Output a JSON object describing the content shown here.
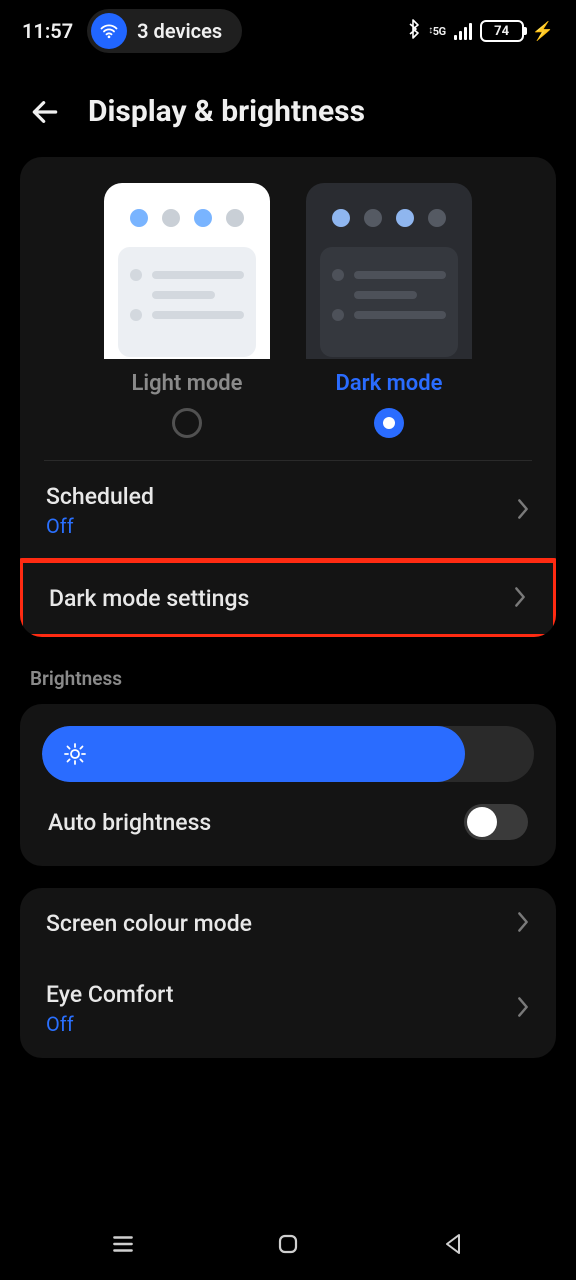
{
  "statusbar": {
    "time": "11:57",
    "devices_label": "3 devices",
    "network_label": "5G",
    "battery": "74"
  },
  "header": {
    "title": "Display & brightness"
  },
  "theme": {
    "light_label": "Light mode",
    "dark_label": "Dark mode",
    "selected": "dark"
  },
  "rows": {
    "scheduled": {
      "label": "Scheduled",
      "value": "Off"
    },
    "dark_settings": {
      "label": "Dark mode settings"
    },
    "auto_brightness": {
      "label": "Auto brightness",
      "on": false
    },
    "screen_colour": {
      "label": "Screen colour mode"
    },
    "eye_comfort": {
      "label": "Eye Comfort",
      "value": "Off"
    }
  },
  "sections": {
    "brightness": "Brightness"
  },
  "brightness": {
    "level_pct": 86
  }
}
